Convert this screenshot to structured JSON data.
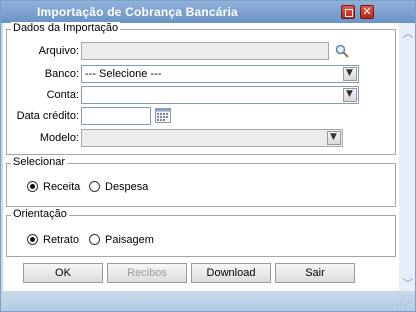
{
  "window": {
    "title": "Importação de Cobrança Bancária"
  },
  "import_group": {
    "legend": "Dados da Importação",
    "arquivo_label": "Arquivo:",
    "arquivo_value": "",
    "banco_label": "Banco:",
    "banco_value": "--- Selecione ---",
    "conta_label": "Conta:",
    "conta_value": "",
    "data_credito_label": "Data crédito:",
    "data_credito_value": "",
    "modelo_label": "Modelo:",
    "modelo_value": ""
  },
  "selecionar_group": {
    "legend": "Selecionar",
    "options": [
      {
        "label": "Receita",
        "selected": true
      },
      {
        "label": "Despesa",
        "selected": false
      }
    ]
  },
  "orientacao_group": {
    "legend": "Orientação",
    "options": [
      {
        "label": "Retrato",
        "selected": true
      },
      {
        "label": "Paisagem",
        "selected": false
      }
    ]
  },
  "buttons": {
    "ok": "OK",
    "recibos": "Recibos",
    "download": "Download",
    "sair": "Sair"
  },
  "icons": {
    "minimize": "minimize-icon",
    "close": "close-icon",
    "search": "search-icon",
    "calendar": "calendar-icon",
    "dropdown": "chevron-down-icon"
  },
  "colors": {
    "titlebar": "#7a9fd0",
    "window_frame": "#c9d9ec",
    "title_button": "#d0392b"
  }
}
